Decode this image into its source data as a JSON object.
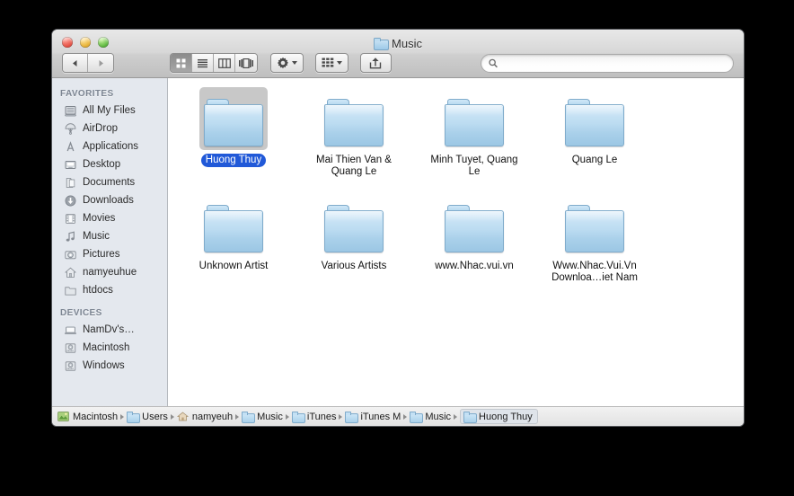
{
  "window": {
    "title": "Music",
    "title_icon": "folder-icon",
    "traffic_lights": [
      {
        "name": "close-button",
        "color": "#e7564a"
      },
      {
        "name": "minimize-button",
        "color": "#e9b43a"
      },
      {
        "name": "zoom-button",
        "color": "#64bb45"
      }
    ]
  },
  "toolbar": {
    "back_icon": "chevron-left-icon",
    "forward_icon": "chevron-right-icon",
    "views": [
      {
        "name": "icon-view-button",
        "icon": "grid-icon",
        "active": true
      },
      {
        "name": "list-view-button",
        "icon": "list-icon",
        "active": false
      },
      {
        "name": "column-view-button",
        "icon": "columns-icon",
        "active": false
      },
      {
        "name": "coverflow-view-button",
        "icon": "coverflow-icon",
        "active": false
      }
    ],
    "action_icon": "gear-icon",
    "arrange_icon": "arrange-grid-icon",
    "share_icon": "share-arrow-icon"
  },
  "search": {
    "icon": "search-icon",
    "value": "",
    "placeholder": ""
  },
  "sidebar": {
    "sections": [
      {
        "header": "FAVORITES",
        "items": [
          {
            "label": "All My Files",
            "icon": "all-my-files-icon"
          },
          {
            "label": "AirDrop",
            "icon": "airdrop-icon"
          },
          {
            "label": "Applications",
            "icon": "applications-icon"
          },
          {
            "label": "Desktop",
            "icon": "desktop-icon"
          },
          {
            "label": "Documents",
            "icon": "documents-icon"
          },
          {
            "label": "Downloads",
            "icon": "downloads-icon"
          },
          {
            "label": "Movies",
            "icon": "movies-icon"
          },
          {
            "label": "Music",
            "icon": "music-note-icon"
          },
          {
            "label": "Pictures",
            "icon": "pictures-camera-icon"
          },
          {
            "label": "namyeuhue",
            "icon": "home-icon"
          },
          {
            "label": "htdocs",
            "icon": "folder-icon"
          }
        ]
      },
      {
        "header": "DEVICES",
        "items": [
          {
            "label": "NamDv's…",
            "icon": "laptop-icon"
          },
          {
            "label": "Macintosh",
            "icon": "hard-drive-icon"
          },
          {
            "label": "Windows",
            "icon": "hard-drive-icon"
          }
        ]
      }
    ]
  },
  "files": [
    {
      "label": "Huong Thuy",
      "icon": "folder-icon",
      "selected": true
    },
    {
      "label": "Mai Thien Van & Quang Le",
      "icon": "folder-icon",
      "selected": false
    },
    {
      "label": "Minh Tuyet, Quang Le",
      "icon": "folder-icon",
      "selected": false
    },
    {
      "label": "Quang Le",
      "icon": "folder-icon",
      "selected": false
    },
    {
      "label": "Unknown Artist",
      "icon": "folder-icon",
      "selected": false
    },
    {
      "label": "Various Artists",
      "icon": "folder-icon",
      "selected": false
    },
    {
      "label": "www.Nhac.vui.vn",
      "icon": "folder-icon",
      "selected": false
    },
    {
      "label": "Www.Nhac.Vui.Vn Downloa…iet Nam",
      "icon": "folder-icon",
      "selected": false
    }
  ],
  "pathbar": [
    {
      "label": "Macintosh",
      "icon": "hard-drive-icon"
    },
    {
      "label": "Users",
      "icon": "users-folder-icon"
    },
    {
      "label": "namyeuh",
      "icon": "home-folder-icon"
    },
    {
      "label": "Music",
      "icon": "music-folder-icon"
    },
    {
      "label": "iTunes",
      "icon": "folder-icon"
    },
    {
      "label": "iTunes M",
      "icon": "folder-icon"
    },
    {
      "label": "Music",
      "icon": "folder-icon"
    },
    {
      "label": "Huong Thuy",
      "icon": "folder-icon"
    }
  ],
  "colors": {
    "selection_blue": "#2159d8",
    "sidebar_bg": "#e4e8ee",
    "folder_blue": "#a9d0ea"
  }
}
